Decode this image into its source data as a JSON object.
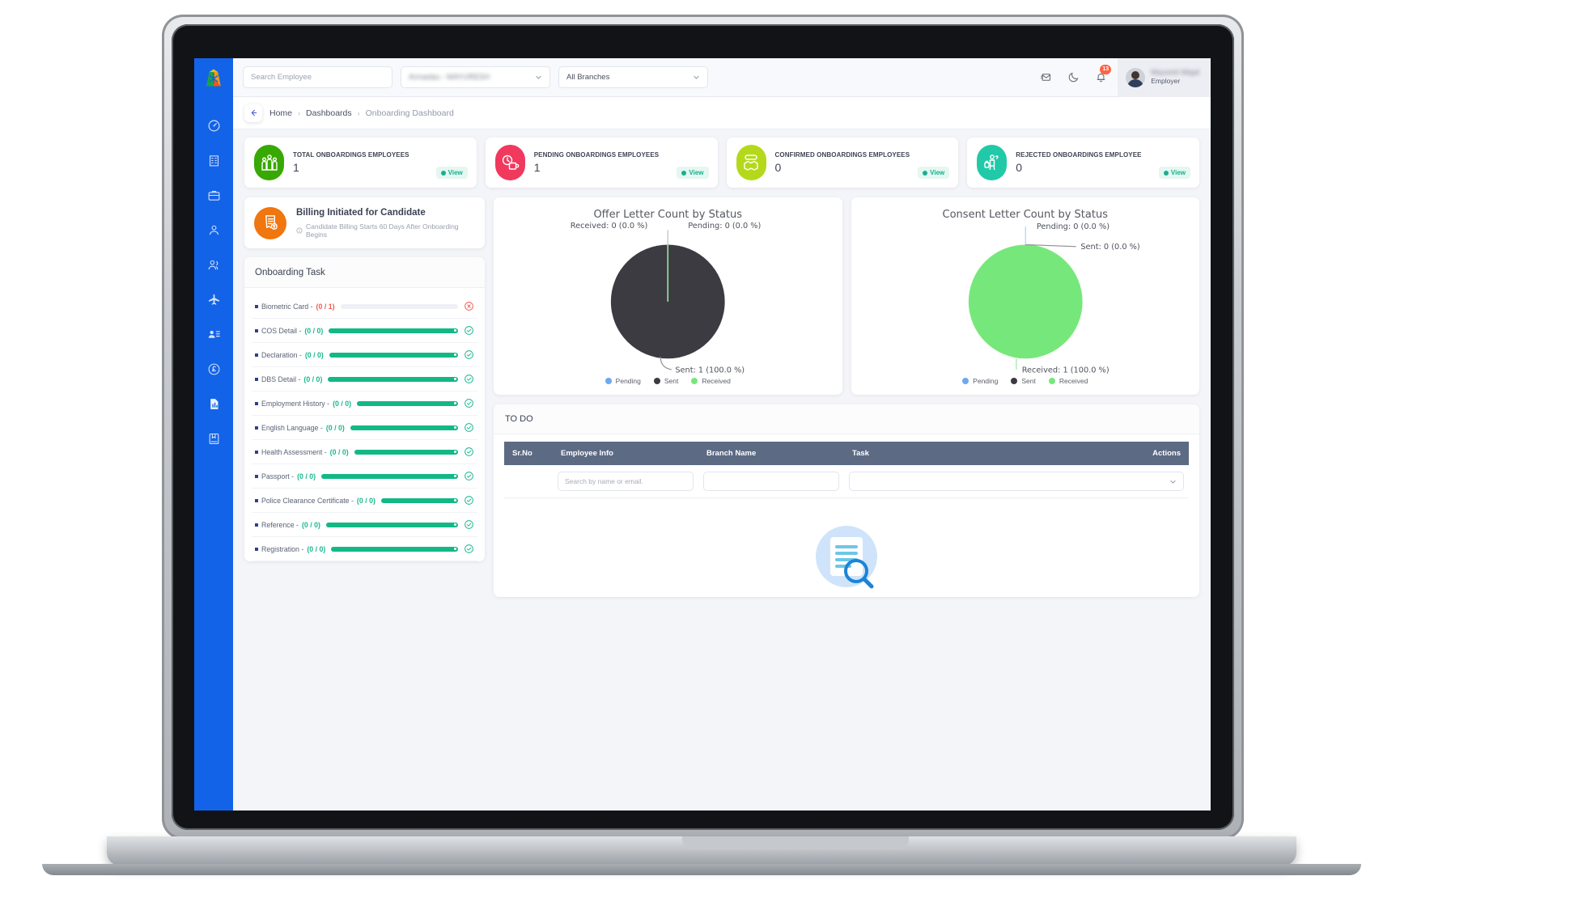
{
  "topbar": {
    "logo_icon": "app-logo-icon",
    "search_placeholder": "Search Employee",
    "company_select_value": "Armadau - MAYURESH",
    "branch_select_value": "All Branches",
    "mail_icon": "mail-icon",
    "theme_icon": "moon-icon",
    "bell_icon": "bell-icon",
    "notification_count": "13",
    "user_name": "Mayuresh Wagal",
    "user_role": "Employer"
  },
  "sidebar": {
    "items": [
      {
        "icon": "dashboard-speedometer-icon",
        "name": "dashboard"
      },
      {
        "icon": "building-icon",
        "name": "company"
      },
      {
        "icon": "briefcase-icon",
        "name": "jobs"
      },
      {
        "icon": "user-icon",
        "name": "employee"
      },
      {
        "icon": "users-group-icon",
        "name": "teams"
      },
      {
        "icon": "airplane-icon",
        "name": "travel"
      },
      {
        "icon": "contact-card-icon",
        "name": "contacts"
      },
      {
        "icon": "pound-currency-icon",
        "name": "payroll"
      },
      {
        "icon": "report-document-icon",
        "name": "reports"
      },
      {
        "icon": "book-icon",
        "name": "records"
      }
    ]
  },
  "breadcrumb": {
    "back_icon": "back-arrow-icon",
    "items": [
      "Home",
      "Dashboards",
      "Onboarding Dashboard"
    ],
    "separator": "›"
  },
  "stats": [
    {
      "label": "TOTAL ONBOARDINGS EMPLOYEES",
      "value": "1",
      "view": "View",
      "color": "#38a803",
      "icon": "group-people-icon"
    },
    {
      "label": "PENDING ONBOARDINGS EMPLOYEES",
      "value": "1",
      "view": "View",
      "color": "#f0395d",
      "icon": "clock-pending-icon"
    },
    {
      "label": "CONFIRMED ONBOARDINGS EMPLOYEES",
      "value": "0",
      "view": "View",
      "color": "#b4d91b",
      "icon": "hired-handshake-icon"
    },
    {
      "label": "REJECTED ONBOARDINGS EMPLOYEE",
      "value": "0",
      "view": "View",
      "color": "#21c9a8",
      "icon": "rejected-traveler-icon"
    }
  ],
  "billing": {
    "icon": "invoice-icon",
    "title": "Billing Initiated for Candidate",
    "note_icon": "info-icon",
    "note": "Candidate Billing Starts 60 Days After Onboarding Begins"
  },
  "onboarding_task": {
    "title": "Onboarding Task",
    "rows": [
      {
        "label": "Biometric Card",
        "count": "(0 / 1)",
        "state": "bad",
        "percent": 0
      },
      {
        "label": "COS Detail",
        "count": "(0 / 0)",
        "state": "ok",
        "percent": 100
      },
      {
        "label": "Declaration",
        "count": "(0 / 0)",
        "state": "ok",
        "percent": 100
      },
      {
        "label": "DBS Detail",
        "count": "(0 / 0)",
        "state": "ok",
        "percent": 100
      },
      {
        "label": "Employment History",
        "count": "(0 / 0)",
        "state": "ok",
        "percent": 100
      },
      {
        "label": "English Language",
        "count": "(0 / 0)",
        "state": "ok",
        "percent": 100
      },
      {
        "label": "Health Assessment",
        "count": "(0 / 0)",
        "state": "ok",
        "percent": 100
      },
      {
        "label": "Passport",
        "count": "(0 / 0)",
        "state": "ok",
        "percent": 100
      },
      {
        "label": "Police Clearance Certificate",
        "count": "(0 / 0)",
        "state": "ok",
        "percent": 100
      },
      {
        "label": "Reference",
        "count": "(0 / 0)",
        "state": "ok",
        "percent": 100
      },
      {
        "label": "Registration",
        "count": "(0 / 0)",
        "state": "ok",
        "percent": 100
      }
    ]
  },
  "chart_data": [
    {
      "type": "pie",
      "title": "Offer Letter Count by Status",
      "categories": [
        "Pending",
        "Sent",
        "Received"
      ],
      "values": [
        0,
        1,
        0
      ],
      "percents": [
        0.0,
        100.0,
        0.0
      ],
      "colors": [
        "#6fa8f0",
        "#3b3b41",
        "#76e87b"
      ],
      "labels": [
        "Pending: 0 (0.0 %)",
        "Sent: 1 (100.0 %)",
        "Received: 0 (0.0 %)"
      ],
      "label_received": "Received: 0 (0.0 %)",
      "label_pending": "Pending: 0 (0.0 %)",
      "label_sent": "Sent: 1 (100.0 %)",
      "legend": [
        "Pending",
        "Sent",
        "Received"
      ],
      "legend_position": "bottom"
    },
    {
      "type": "pie",
      "title": "Consent Letter Count by Status",
      "categories": [
        "Pending",
        "Sent",
        "Received"
      ],
      "values": [
        0,
        0,
        1
      ],
      "percents": [
        0.0,
        0.0,
        100.0
      ],
      "colors": [
        "#6fa8f0",
        "#3b3b41",
        "#76e87b"
      ],
      "labels": [
        "Pending: 0 (0.0 %)",
        "Sent: 0 (0.0 %)",
        "Received: 1 (100.0 %)"
      ],
      "label_pending": "Pending: 0 (0.0 %)",
      "label_sent": "Sent: 0 (0.0 %)",
      "label_received": "Received: 1 (100.0 %)",
      "legend": [
        "Pending",
        "Sent",
        "Received"
      ],
      "legend_position": "bottom"
    }
  ],
  "todo": {
    "title": "TO DO",
    "columns": [
      "Sr.No",
      "Employee Info",
      "Branch Name",
      "Task",
      "Actions"
    ],
    "filters": {
      "employee_placeholder": "Search by name or email.",
      "branch_value": "",
      "task_value": ""
    },
    "empty_illustration": "document-search-illustration"
  },
  "colors": {
    "sidebar": "#1363e8",
    "accent_green": "#12b886",
    "table_header": "#5c6a84",
    "badge_red": "#ff6243"
  }
}
